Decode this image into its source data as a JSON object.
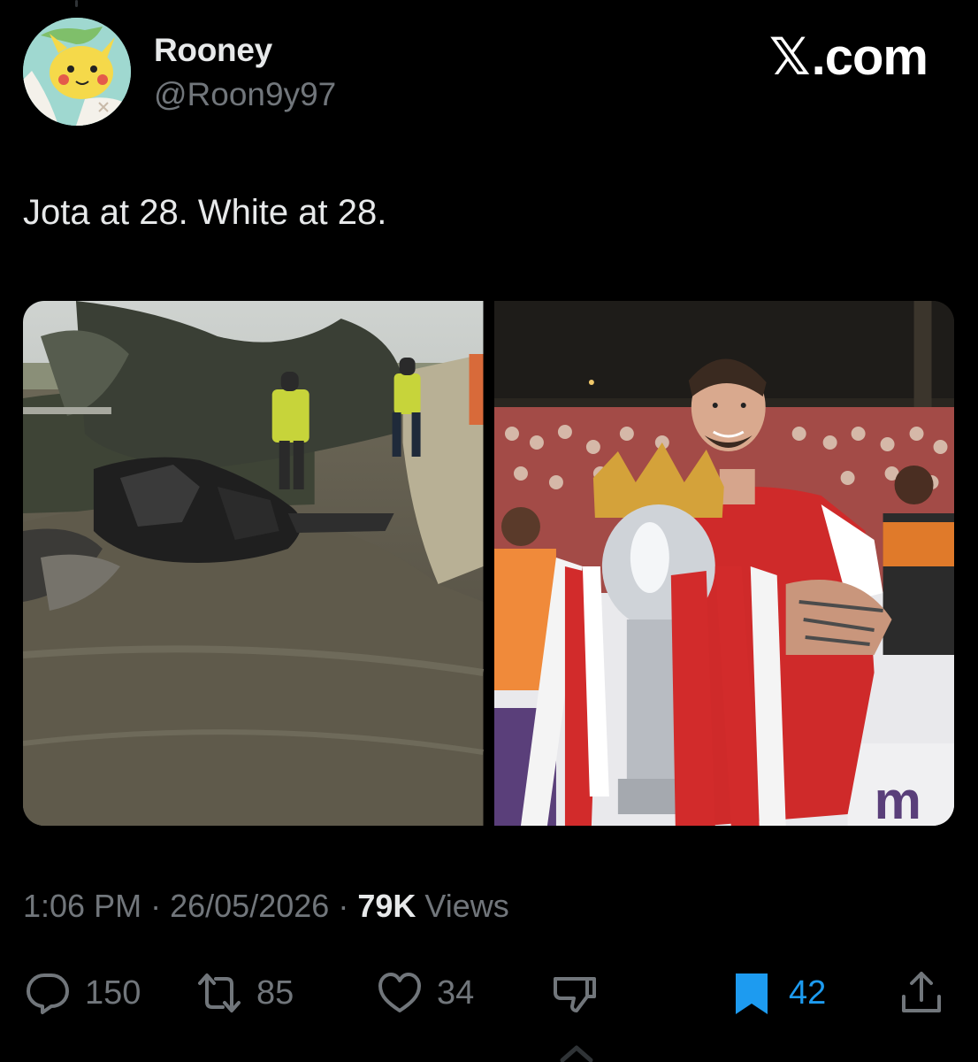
{
  "user": {
    "display_name": "Rooney",
    "handle": "@Roon9y97",
    "avatar_icon": "pikachu-avatar"
  },
  "brand": {
    "x_mark": "𝕏",
    "suffix": ".com"
  },
  "tweet": {
    "text": "Jota at 28. White at 28.",
    "media": [
      {
        "description_icon": "burnt-car-wreck-photo"
      },
      {
        "description_icon": "footballer-with-trophy-photo"
      }
    ]
  },
  "meta": {
    "time": "1:06 PM",
    "separator": "·",
    "date": "26/05/2026",
    "views_count": "79K",
    "views_label": "Views"
  },
  "actions": {
    "replies": "150",
    "reposts": "85",
    "likes": "34",
    "bookmarks": "42"
  },
  "colors": {
    "background": "#000000",
    "text_primary": "#e7e9ea",
    "text_secondary": "#71767b",
    "accent": "#1d9bf0"
  }
}
